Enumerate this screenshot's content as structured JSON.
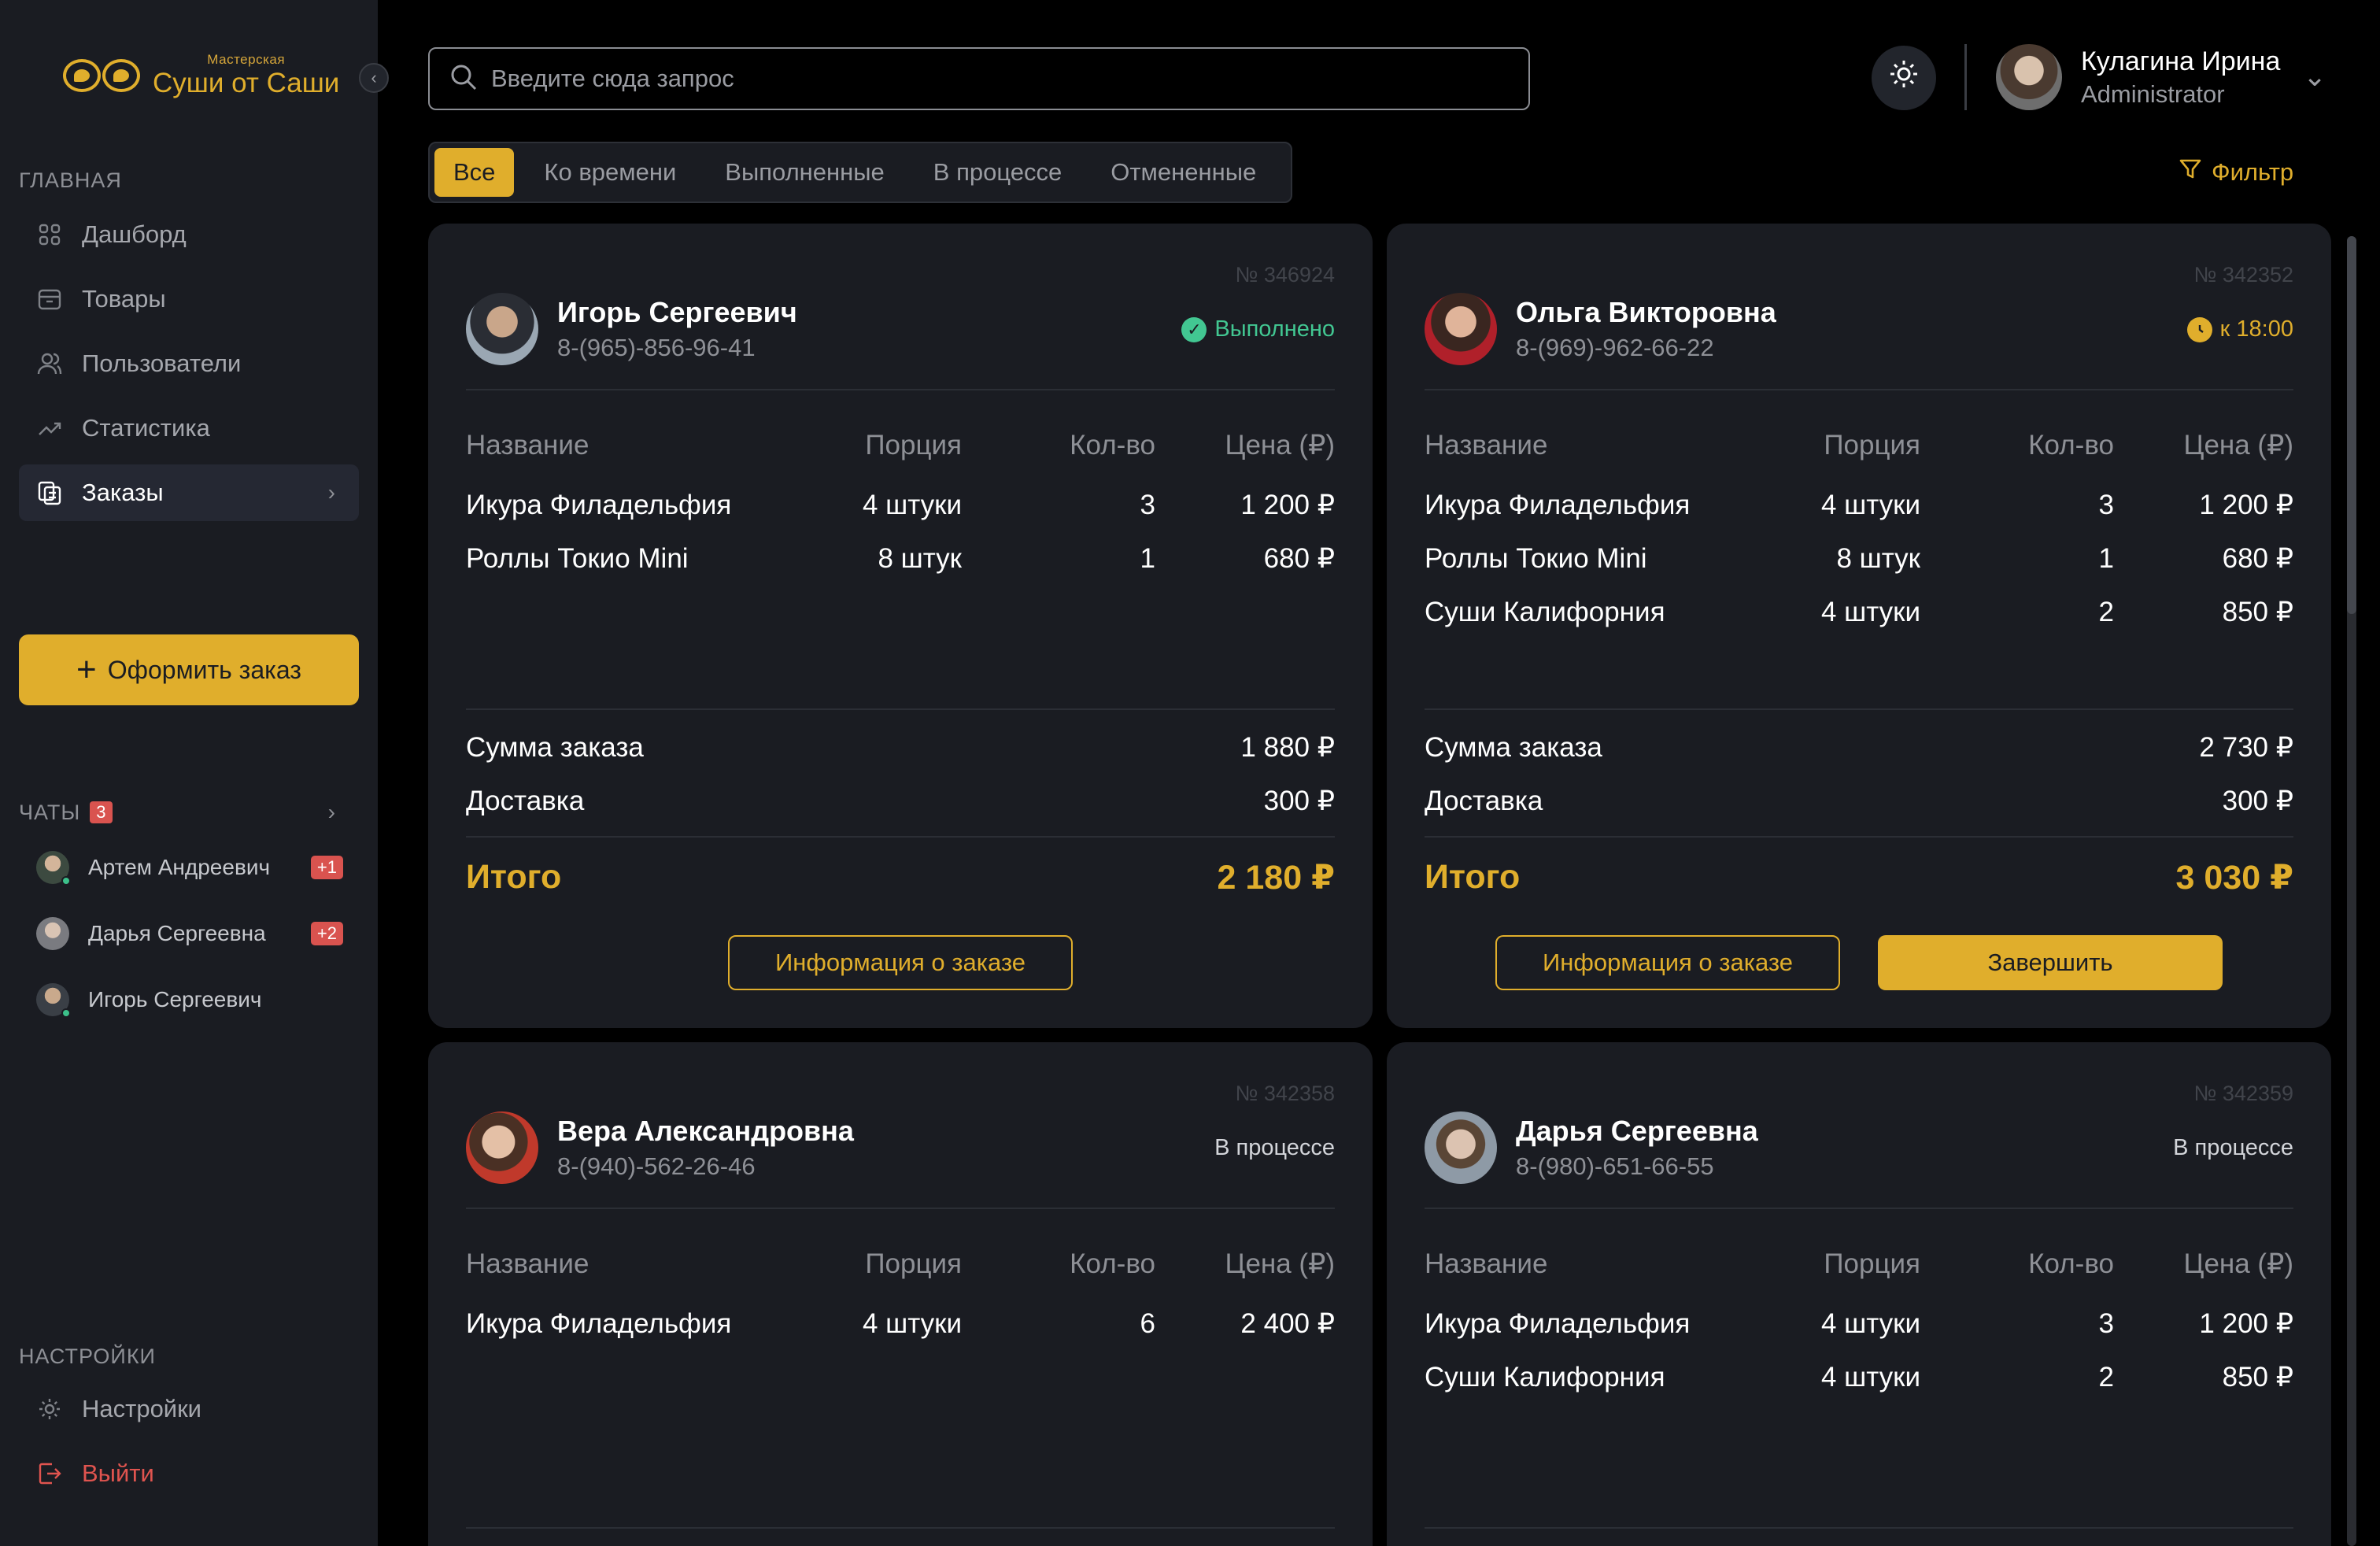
{
  "brand": {
    "small": "Мастерская",
    "name": "Суши от Саши"
  },
  "sidebar": {
    "main_title": "ГЛАВНАЯ",
    "items": [
      {
        "label": "Дашборд",
        "icon": "dashboard-icon"
      },
      {
        "label": "Товары",
        "icon": "box-icon"
      },
      {
        "label": "Пользователи",
        "icon": "users-icon"
      },
      {
        "label": "Статистика",
        "icon": "chart-icon"
      },
      {
        "label": "Заказы",
        "icon": "orders-icon"
      }
    ],
    "order_button": "Оформить заказ",
    "chats_title": "ЧАТЫ",
    "chats_count": "3",
    "chats": [
      {
        "name": "Артем Андреевич",
        "badge": "+1"
      },
      {
        "name": "Дарья Сергеевна",
        "badge": "+2"
      },
      {
        "name": "Игорь Сергеевич",
        "badge": ""
      }
    ],
    "settings_title": "НАСТРОЙКИ",
    "settings_label": "Настройки",
    "logout_label": "Выйти"
  },
  "search": {
    "placeholder": "Введите сюда запрос"
  },
  "user": {
    "name": "Кулагина Ирина",
    "role": "Administrator"
  },
  "tabs": [
    "Все",
    "Ко времени",
    "Выполненные",
    "В процессе",
    "Отмененные"
  ],
  "filter_label": "Фильтр",
  "table_headers": {
    "name": "Название",
    "portion": "Порция",
    "qty": "Кол-во",
    "price": "Цена (₽)"
  },
  "labels": {
    "sum": "Сумма заказа",
    "delivery": "Доставка",
    "total": "Итого",
    "info_button": "Информация о заказе",
    "finish_button": "Завершить"
  },
  "orders": [
    {
      "number": "№ 346924",
      "client": "Игорь Сергеевич",
      "phone": "8-(965)-856-96-41",
      "status": "Выполнено",
      "items": [
        {
          "name": "Икура Филадельфия",
          "portion": "4 штуки",
          "qty": "3",
          "price": "1 200 ₽"
        },
        {
          "name": "Роллы Токио Mini",
          "portion": "8 штук",
          "qty": "1",
          "price": "680 ₽"
        }
      ],
      "sum": "1 880 ₽",
      "delivery": "300 ₽",
      "total": "2 180 ₽"
    },
    {
      "number": "№ 342352",
      "client": "Ольга Викторовна",
      "phone": "8-(969)-962-66-22",
      "status": "к 18:00",
      "items": [
        {
          "name": "Икура Филадельфия",
          "portion": "4 штуки",
          "qty": "3",
          "price": "1 200 ₽"
        },
        {
          "name": "Роллы Токио Mini",
          "portion": "8 штук",
          "qty": "1",
          "price": "680 ₽"
        },
        {
          "name": "Суши Калифорния",
          "portion": "4 штуки",
          "qty": "2",
          "price": "850 ₽"
        }
      ],
      "sum": "2 730 ₽",
      "delivery": "300 ₽",
      "total": "3 030 ₽"
    },
    {
      "number": "№ 342358",
      "client": "Вера Александровна",
      "phone": "8-(940)-562-26-46",
      "status": "В процессе",
      "items": [
        {
          "name": "Икура Филадельфия",
          "portion": "4 штуки",
          "qty": "6",
          "price": "2 400 ₽"
        }
      ]
    },
    {
      "number": "№ 342359",
      "client": "Дарья Сергеевна",
      "phone": "8-(980)-651-66-55",
      "status": "В процессе",
      "items": [
        {
          "name": "Икура Филадельфия",
          "portion": "4 штуки",
          "qty": "3",
          "price": "1 200 ₽"
        },
        {
          "name": "Суши Калифорния",
          "portion": "4 штуки",
          "qty": "2",
          "price": "850 ₽"
        }
      ]
    }
  ],
  "colors": {
    "accent": "#e0ae2c",
    "done": "#42c792",
    "danger": "#d9534f",
    "panel": "#1a1c22",
    "background": "#000000"
  }
}
